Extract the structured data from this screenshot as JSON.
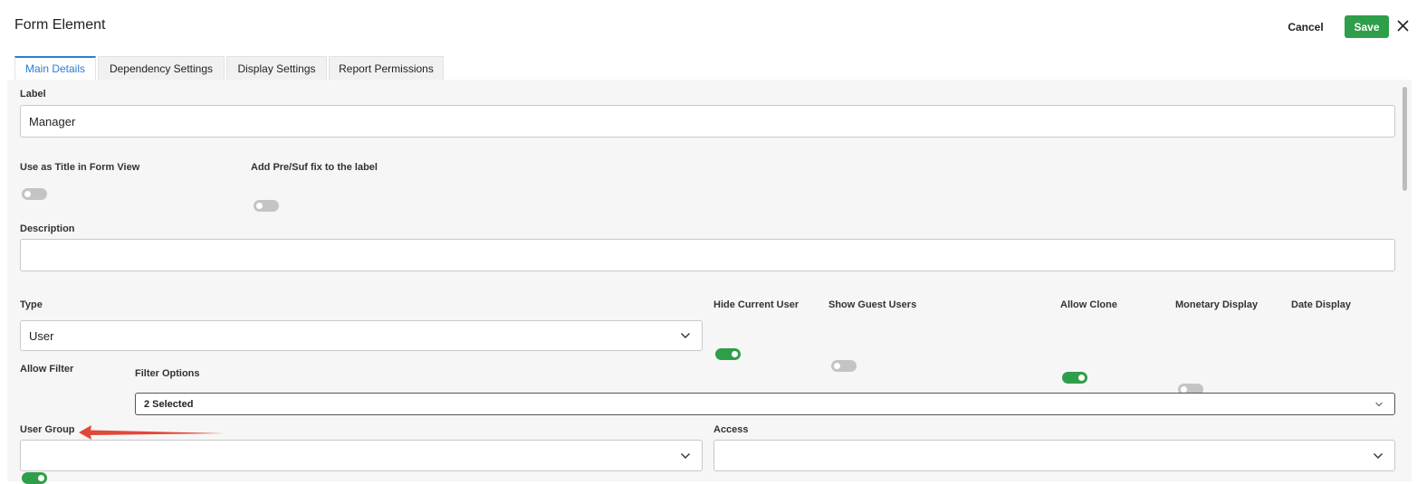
{
  "header": {
    "title": "Form Element",
    "cancel_label": "Cancel",
    "save_label": "Save",
    "close_icon": "close-icon"
  },
  "tabs": [
    {
      "label": "Main Details",
      "active": true
    },
    {
      "label": "Dependency Settings",
      "active": false
    },
    {
      "label": "Display Settings",
      "active": false
    },
    {
      "label": "Report Permissions",
      "active": false
    }
  ],
  "form": {
    "label": {
      "title": "Label",
      "value": "Manager"
    },
    "use_as_title": {
      "title": "Use as Title in Form View",
      "on": false
    },
    "add_presuffix": {
      "title": "Add Pre/Suf fix to the label",
      "on": false
    },
    "description": {
      "title": "Description",
      "value": ""
    },
    "type": {
      "title": "Type",
      "value": "User"
    },
    "hide_current_user": {
      "title": "Hide Current User",
      "on": true
    },
    "show_guest_users": {
      "title": "Show Guest Users",
      "on": false
    },
    "allow_clone": {
      "title": "Allow Clone",
      "on": true
    },
    "monetary_display": {
      "title": "Monetary Display",
      "on": false
    },
    "date_display": {
      "title": "Date Display",
      "on": false
    },
    "allow_filter": {
      "title": "Allow Filter",
      "on": true
    },
    "filter_options": {
      "title": "Filter Options",
      "value": "2 Selected"
    },
    "user_group": {
      "title": "User Group",
      "value": ""
    },
    "access": {
      "title": "Access",
      "value": ""
    }
  },
  "colors": {
    "accent_blue": "#2b7bd6",
    "success_green": "#2e9e4a",
    "annotation_red": "#e0483a"
  }
}
